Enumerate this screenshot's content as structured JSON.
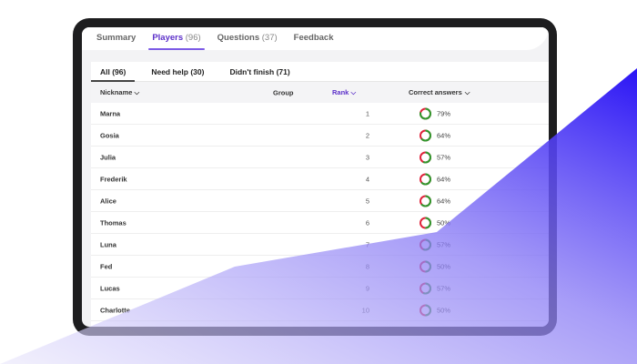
{
  "tabs": [
    {
      "label": "Summary",
      "count": ""
    },
    {
      "label": "Players",
      "count": "(96)"
    },
    {
      "label": "Questions",
      "count": "(37)"
    },
    {
      "label": "Feedback",
      "count": ""
    }
  ],
  "subtabs": [
    "All (96)",
    "Need help (30)",
    "Didn't finish (71)"
  ],
  "columns": {
    "nickname": "Nickname",
    "group": "Group",
    "rank": "Rank",
    "correct": "Correct answers"
  },
  "rows": [
    {
      "name": "Marna",
      "rank": "1",
      "pct": "79%",
      "value": 79
    },
    {
      "name": "Gosia",
      "rank": "2",
      "pct": "64%",
      "value": 64
    },
    {
      "name": "Julia",
      "rank": "3",
      "pct": "57%",
      "value": 57
    },
    {
      "name": "Frederik",
      "rank": "4",
      "pct": "64%",
      "value": 64
    },
    {
      "name": "Alice",
      "rank": "5",
      "pct": "64%",
      "value": 64
    },
    {
      "name": "Thomas",
      "rank": "6",
      "pct": "50%",
      "value": 50
    },
    {
      "name": "Luna",
      "rank": "7",
      "pct": "57%",
      "value": 57
    },
    {
      "name": "Fed",
      "rank": "8",
      "pct": "50%",
      "value": 50
    },
    {
      "name": "Lucas",
      "rank": "9",
      "pct": "57%",
      "value": 57
    },
    {
      "name": "Charlotte",
      "rank": "10",
      "pct": "50%",
      "value": 50
    }
  ],
  "colors": {
    "accent": "#5b2fc9",
    "correct": "#2e9a2e",
    "wrong": "#e0243c"
  }
}
